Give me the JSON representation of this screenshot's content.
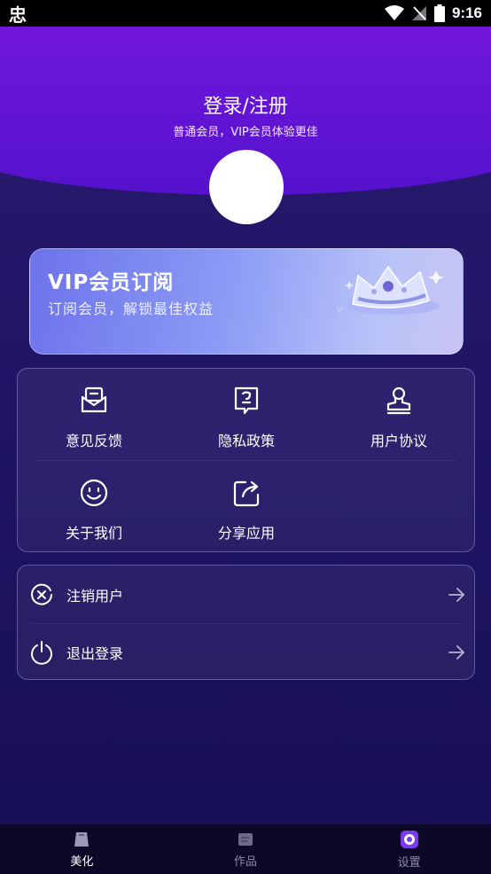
{
  "status_bar": {
    "app_icon": "忠",
    "time": "9:16",
    "icons": [
      "wifi-icon",
      "no-signal-icon",
      "battery-icon"
    ]
  },
  "header": {
    "title": "登录/注册",
    "subtitle": "普通会员，VIP会员体验更佳"
  },
  "vip_banner": {
    "title": "VIP会员订阅",
    "subtitle": "订阅会员，解锁最佳权益"
  },
  "grid_menu": {
    "items": [
      {
        "label": "意见反馈",
        "icon": "feedback-icon"
      },
      {
        "label": "隐私政策",
        "icon": "privacy-icon"
      },
      {
        "label": "用户协议",
        "icon": "agreement-icon"
      },
      {
        "label": "关于我们",
        "icon": "smile-icon"
      },
      {
        "label": "分享应用",
        "icon": "share-icon"
      }
    ]
  },
  "account_menu": {
    "items": [
      {
        "label": "注销用户",
        "icon": "cancel-account-icon"
      },
      {
        "label": "退出登录",
        "icon": "power-icon"
      }
    ]
  },
  "bottom_nav": {
    "items": [
      {
        "label": "美化",
        "icon": "beautify-icon"
      },
      {
        "label": "作品",
        "icon": "works-icon"
      },
      {
        "label": "设置",
        "icon": "settings-icon"
      }
    ],
    "active": "美化"
  },
  "colors": {
    "header_purple": "#7a19e0",
    "background": "#1e1463",
    "accent": "#8b5cf6"
  }
}
